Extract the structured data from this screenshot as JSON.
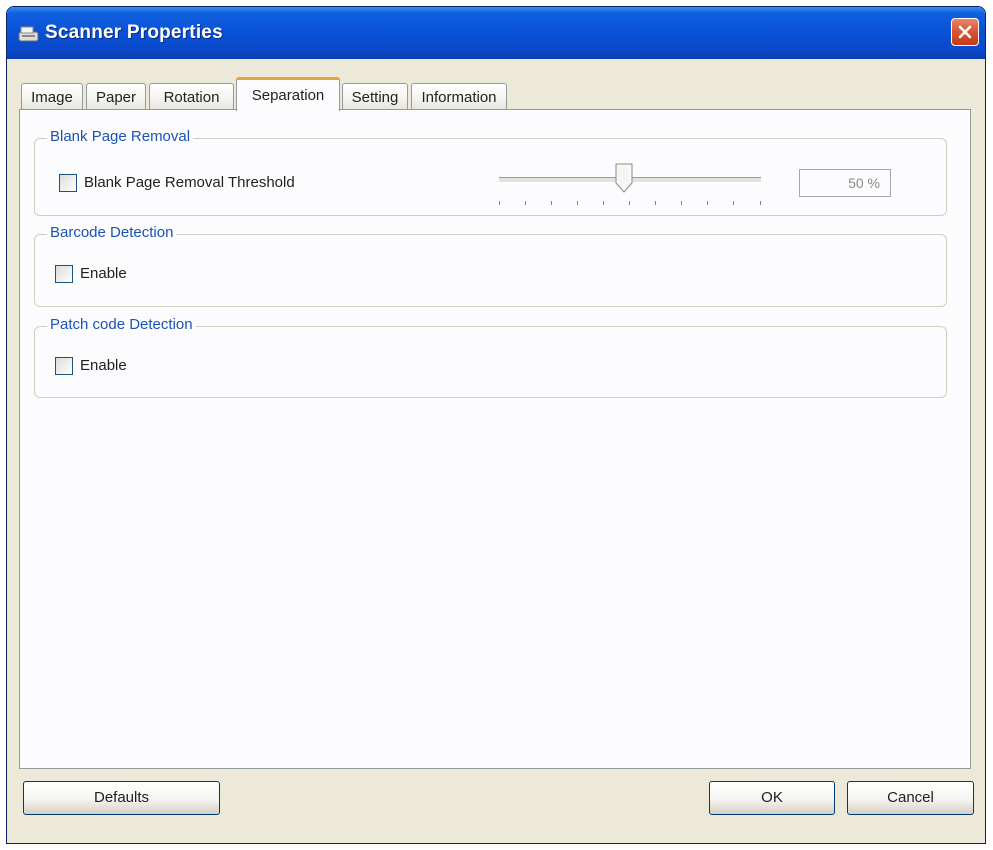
{
  "window": {
    "title": "Scanner Properties"
  },
  "tabs": [
    {
      "label": "Image"
    },
    {
      "label": "Paper"
    },
    {
      "label": "Rotation"
    },
    {
      "label": "Separation",
      "active": true
    },
    {
      "label": "Setting"
    },
    {
      "label": "Information"
    }
  ],
  "groups": {
    "blank_page": {
      "title": "Blank Page Removal",
      "checkbox_label": "Blank Page Removal Threshold",
      "checked": false,
      "threshold_percent": 50,
      "value_text": "50 %"
    },
    "barcode": {
      "title": "Barcode Detection",
      "checkbox_label": "Enable",
      "checked": false
    },
    "patch_code": {
      "title": "Patch code Detection",
      "checkbox_label": "Enable",
      "checked": false
    }
  },
  "buttons": {
    "defaults": "Defaults",
    "ok": "OK",
    "cancel": "Cancel"
  },
  "colors": {
    "titlebar": "#0a4fd3",
    "close": "#d9573a",
    "group_title": "#1b52b8",
    "active_tab_accent": "#e8a33a"
  },
  "icons": {
    "app": "scanner-icon",
    "close": "close-icon"
  }
}
